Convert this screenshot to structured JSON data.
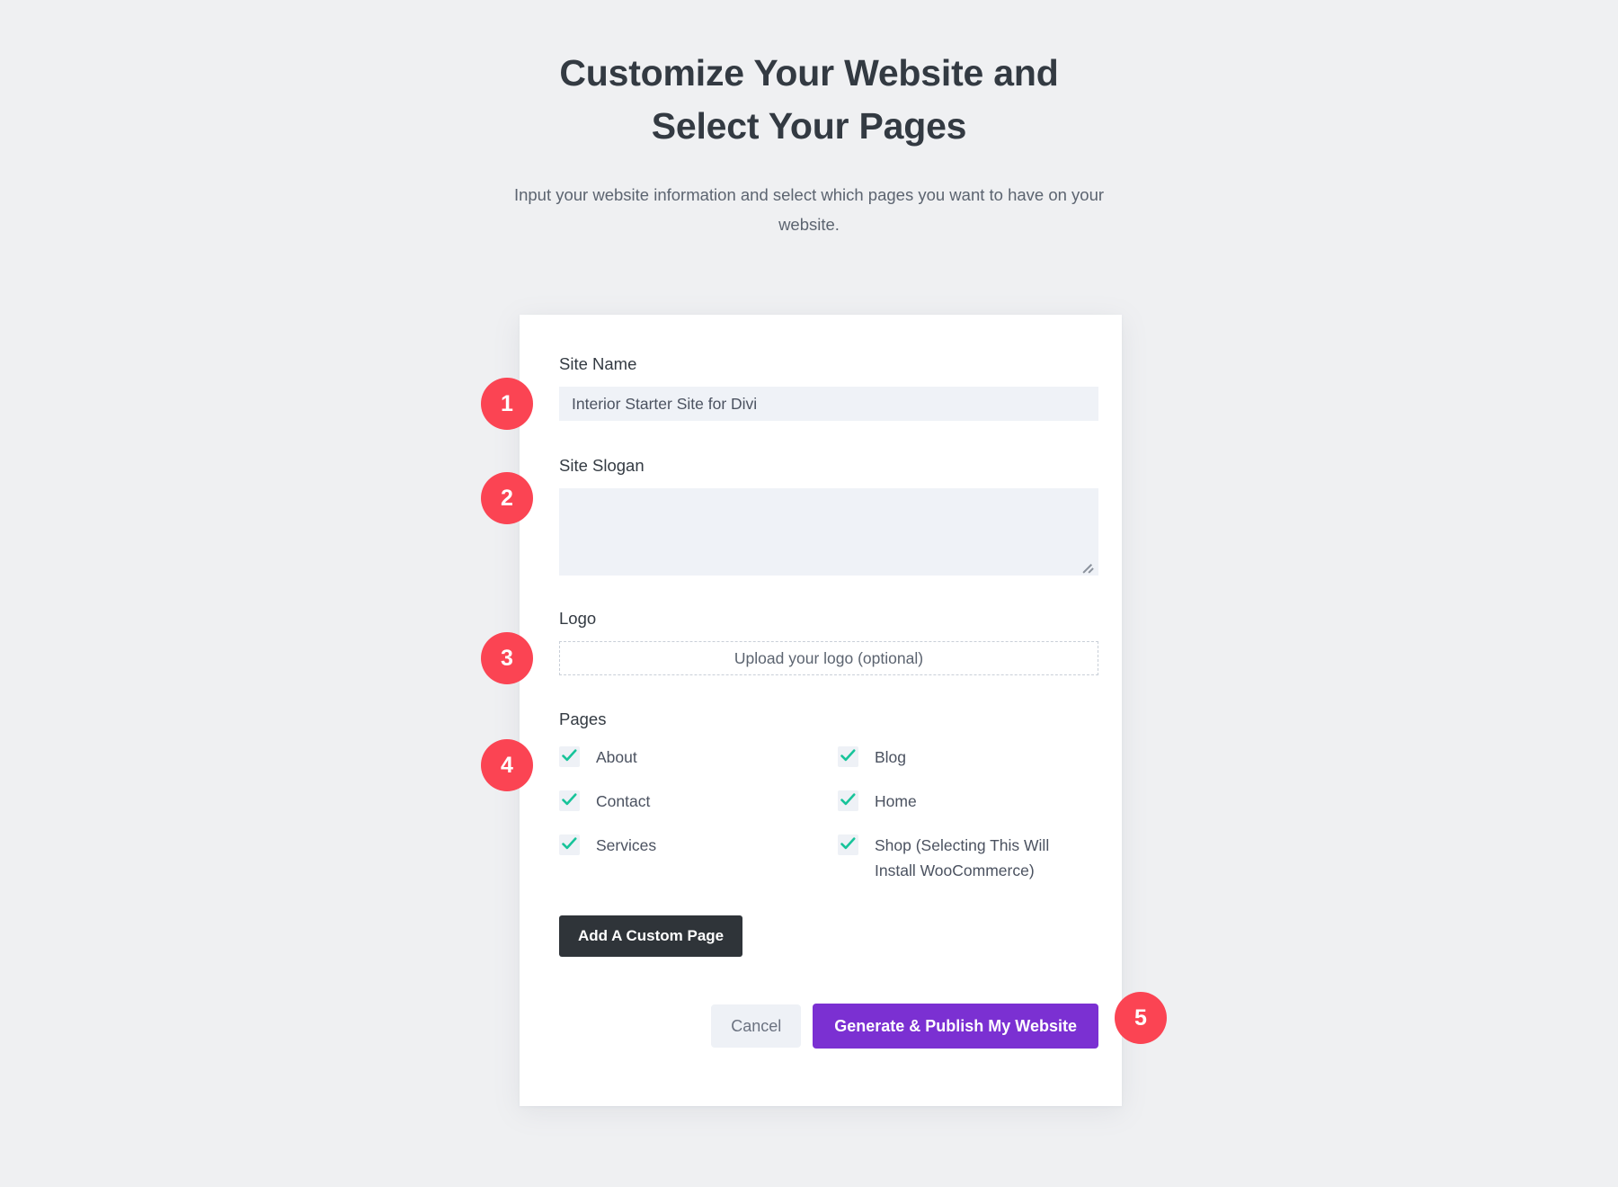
{
  "header": {
    "title": "Customize Your Website and Select Your Pages",
    "subtitle": "Input your website information and select which pages you want to have on your website."
  },
  "form": {
    "site_name": {
      "label": "Site Name",
      "value": "Interior Starter Site for Divi",
      "placeholder": ""
    },
    "site_slogan": {
      "label": "Site Slogan",
      "value": "",
      "placeholder": ""
    },
    "logo": {
      "label": "Logo",
      "upload_text": "Upload your logo (optional)"
    },
    "pages": {
      "label": "Pages",
      "options": [
        {
          "label": "About",
          "checked": true
        },
        {
          "label": "Blog",
          "checked": true
        },
        {
          "label": "Contact",
          "checked": true
        },
        {
          "label": "Home",
          "checked": true
        },
        {
          "label": "Services",
          "checked": true
        },
        {
          "label": "Shop (Selecting This Will Install WooCommerce)",
          "checked": true
        }
      ]
    },
    "add_custom_page_label": "Add A Custom Page",
    "cancel_label": "Cancel",
    "generate_label": "Generate & Publish My Website"
  },
  "badges": [
    {
      "number": "1"
    },
    {
      "number": "2"
    },
    {
      "number": "3"
    },
    {
      "number": "4"
    },
    {
      "number": "5"
    }
  ],
  "colors": {
    "page_background": "#eff0f2",
    "card_background": "#ffffff",
    "heading": "#333a42",
    "input_background": "#eff2f7",
    "checkbox_check": "#18c49a",
    "badge_red": "#fb4453",
    "primary_purple": "#7b30d2",
    "dark_button": "#2f3439"
  }
}
